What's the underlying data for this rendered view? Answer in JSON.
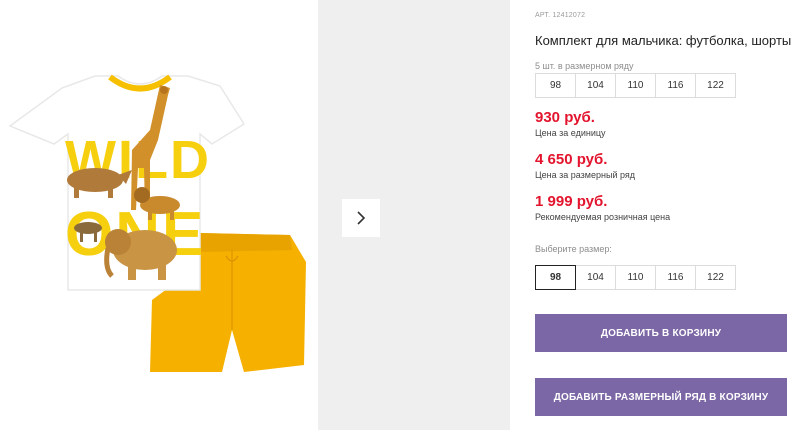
{
  "product": {
    "sku_label": "АРТ.",
    "sku": "12412072",
    "title": "Комплект для мальчика: футболка, шорты",
    "print_text": [
      "WILD",
      "ONE"
    ]
  },
  "size_run": {
    "hint": "5 шт. в размерном ряду",
    "sizes": [
      "98",
      "104",
      "110",
      "116",
      "122"
    ]
  },
  "prices": [
    {
      "amount": "930 руб.",
      "note": "Цена за единицу"
    },
    {
      "amount": "4 650 руб.",
      "note": "Цена за размерный ряд"
    },
    {
      "amount": "1 999 руб.",
      "note": "Рекомендуемая розничная цена"
    }
  ],
  "size_select": {
    "hint": "Выберите размер:",
    "sizes": [
      "98",
      "104",
      "110",
      "116",
      "122"
    ],
    "selected": "98"
  },
  "buttons": {
    "add_to_cart": "ДОБАВИТЬ В КОРЗИНУ",
    "add_run_to_cart": "ДОБАВИТЬ РАЗМЕРНЫЙ РЯД В КОРЗИНУ"
  },
  "colors": {
    "price": "#e3142d",
    "button": "#7c67a6",
    "shirt_print": "#f6cf0e",
    "shorts": "#f5b000"
  },
  "icons": {
    "next": "chevron-right-icon"
  }
}
